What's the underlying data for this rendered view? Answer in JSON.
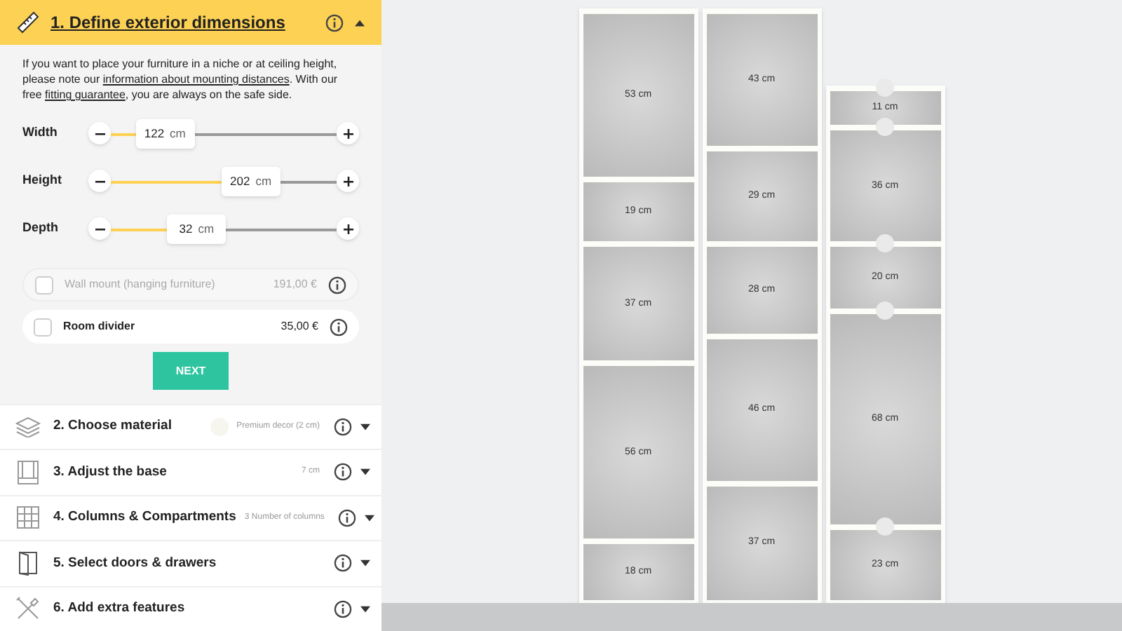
{
  "active_step": {
    "title": "1. Define exterior dimensions",
    "expanded": true,
    "description": [
      {
        "kind": "text",
        "text": "If you want to place your furniture in a niche or at ceiling height, please note our "
      },
      {
        "kind": "link",
        "text": "information about mounting distances"
      },
      {
        "kind": "text",
        "text": ". With our free "
      },
      {
        "kind": "link",
        "text": "fitting guarantee"
      },
      {
        "kind": "text",
        "text": ", you are always on the safe side."
      }
    ],
    "sliders": [
      {
        "label": "Width",
        "value": "122",
        "unit": "cm",
        "level": 0.24
      },
      {
        "label": "Height",
        "value": "202",
        "unit": "cm",
        "level": 0.62
      },
      {
        "label": "Depth",
        "value": "32",
        "unit": "cm",
        "level": 0.38
      }
    ],
    "options": [
      {
        "label": "Wall mount (hanging furniture)",
        "price": "191,00 €",
        "checked": false,
        "disabled": true
      },
      {
        "label": "Room divider",
        "price": "35,00 €",
        "checked": false,
        "disabled": false
      }
    ],
    "next_button": "NEXT"
  },
  "steps": [
    {
      "title": "2. Choose material",
      "summary": "Premium decor (2 cm)",
      "color": "#f7f6ee",
      "expanded": false
    },
    {
      "title": "3. Adjust the base",
      "summary": "7 cm",
      "expanded": false
    },
    {
      "title": "4. Columns & Compartments",
      "summary": "3 Number of columns",
      "expanded": false
    },
    {
      "title": "5. Select doors & drawers",
      "expanded": false
    },
    {
      "title": "6. Add extra features",
      "expanded": false
    }
  ],
  "shelf": {
    "columns": [
      {
        "compartments": [
          "53 cm",
          "19 cm",
          "37 cm",
          "56 cm",
          "18 cm"
        ]
      },
      {
        "compartments": [
          "43 cm",
          "29 cm",
          "28 cm",
          "46 cm",
          "37 cm"
        ]
      },
      {
        "compartments": [
          "11 cm",
          "36 cm",
          "20 cm",
          "68 cm",
          "23 cm"
        ]
      }
    ]
  }
}
